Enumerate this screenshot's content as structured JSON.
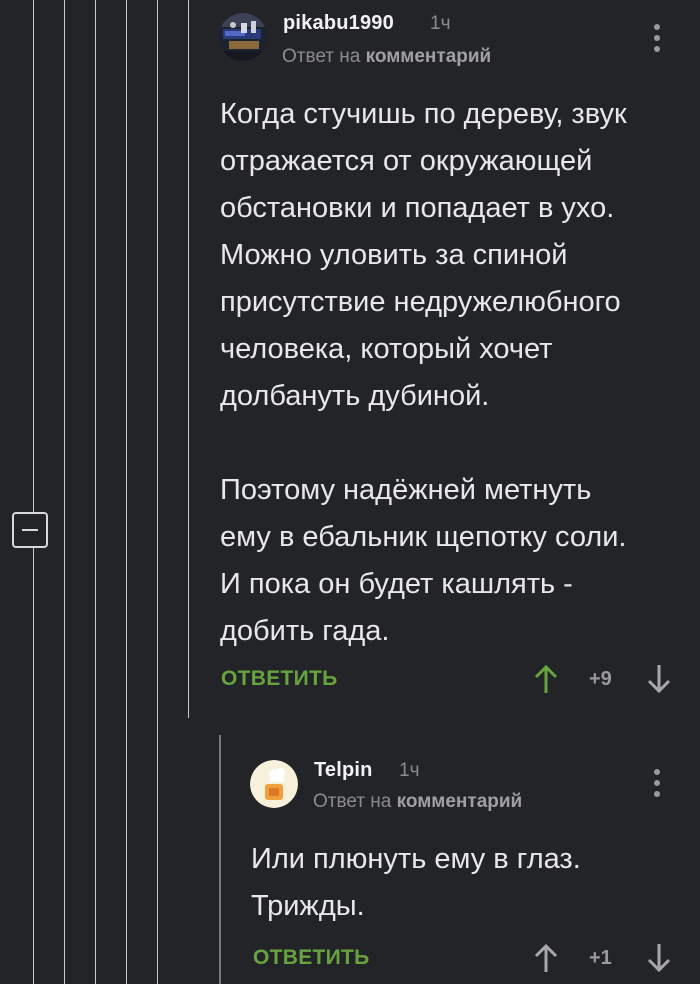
{
  "comments": [
    {
      "username": "pikabu1990",
      "time": "1ч",
      "reply_prefix": "Ответ на",
      "reply_target": "комментарий",
      "text": "Когда стучишь по дереву, звук\nотражается от окружающей\nобстановки и попадает в ухо.\nМожно уловить за спиной\nприсутствие недружелюбного\nчеловека, который хочет\nдолбануть дубиной.\n\nПоэтому надёжней метнуть\nему в ебальник щепотку соли.\nИ пока он будет кашлять -\nдобить гада.",
      "reply_label": "ОТВЕТИТЬ",
      "score": "+9"
    },
    {
      "username": "Telpin",
      "time": "1ч",
      "reply_prefix": "Ответ на",
      "reply_target": "комментарий",
      "text": "Или плюнуть ему в глаз.\nТрижды.",
      "reply_label": "ОТВЕТИТЬ",
      "score": "+1"
    }
  ],
  "icons": {
    "collapse": "minus-square-icon",
    "more": "more-vertical-icon",
    "upvote": "arrow-up-icon",
    "downvote": "arrow-down-icon"
  },
  "colors": {
    "background": "#222427",
    "accent_green": "#67a33f",
    "thread_line": "#c9c9c9",
    "muted_text": "#8c8c8c"
  }
}
